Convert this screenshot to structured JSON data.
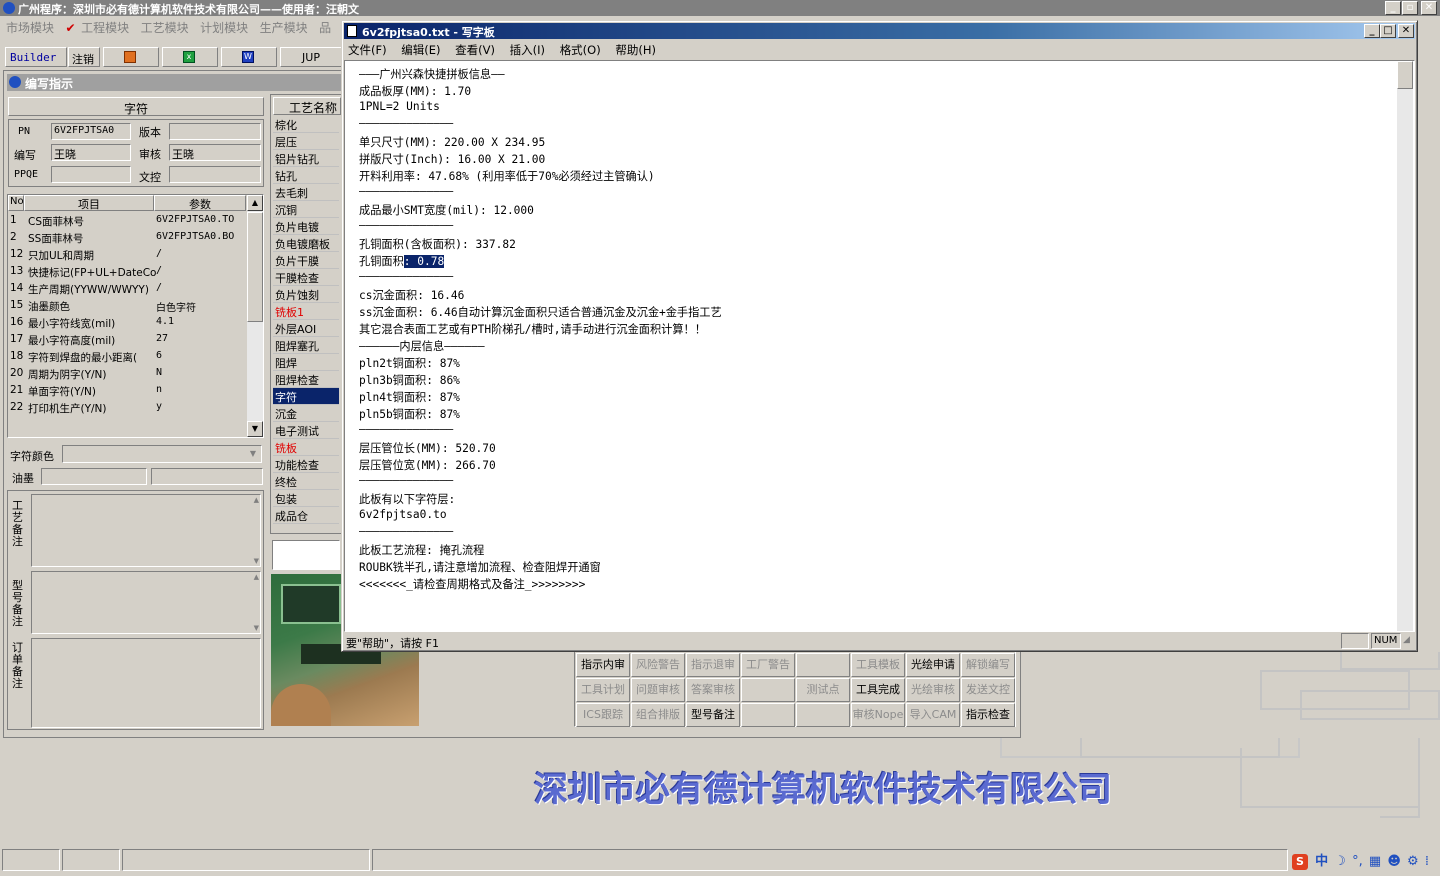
{
  "app": {
    "title": "广州程序：深圳市必有德计算机软件技术有限公司——使用者：汪朝文",
    "menus": [
      "市场模块",
      "工程模块",
      "工艺模块",
      "计划模块",
      "生产模块",
      "品"
    ],
    "toolbar": {
      "builder": "Builder",
      "logout": "注销",
      "jup": "JUP"
    }
  },
  "left_panel": {
    "title": "编写指示",
    "char_header": "字符",
    "pn_label": "PN",
    "pn_value": "6V2FPJTSA0",
    "version_label": "版本",
    "version_value": "",
    "author_label": "编写",
    "author_value": "王晓",
    "review_label": "审核",
    "review_value": "王晓",
    "ppqe_label": "PPQE",
    "ppqe_value": "",
    "doc_label": "文控",
    "doc_value": "",
    "grid_headers": {
      "no": "No",
      "item": "项目",
      "param": "参数"
    },
    "grid_rows": [
      {
        "no": "1",
        "item": "CS面菲林号",
        "value": "6V2FPJTSA0.TO"
      },
      {
        "no": "2",
        "item": "SS面菲林号",
        "value": "6V2FPJTSA0.BO"
      },
      {
        "no": "12",
        "item": "只加UL和周期",
        "value": "/"
      },
      {
        "no": "13",
        "item": "快捷标记(FP+UL+DateCo",
        "value": "/"
      },
      {
        "no": "14",
        "item": "生产周期(YYWW/WWYY)",
        "value": "/"
      },
      {
        "no": "15",
        "item": "油墨颜色",
        "value": "白色字符"
      },
      {
        "no": "16",
        "item": "最小字符线宽(mil)",
        "value": "4.1"
      },
      {
        "no": "17",
        "item": "最小字符高度(mil)",
        "value": "27"
      },
      {
        "no": "18",
        "item": "字符到焊盘的最小距离(",
        "value": "6"
      },
      {
        "no": "20",
        "item": "周期为阴字(Y/N)",
        "value": "N"
      },
      {
        "no": "21",
        "item": "单面字符(Y/N)",
        "value": "n"
      },
      {
        "no": "22",
        "item": "打印机生产(Y/N)",
        "value": "y"
      }
    ],
    "char_color_label": "字符颜色",
    "ink_label": "油墨",
    "process_note_label": "工艺备注",
    "model_note_label": "型号备注",
    "order_note_label": "订单备注"
  },
  "process_list": {
    "header": "工艺名称",
    "items": [
      {
        "label": "棕化",
        "red": false
      },
      {
        "label": "层压",
        "red": false
      },
      {
        "label": "铝片钻孔",
        "red": false
      },
      {
        "label": "钻孔",
        "red": false
      },
      {
        "label": "去毛刺",
        "red": false
      },
      {
        "label": "沉铜",
        "red": false
      },
      {
        "label": "负片电镀",
        "red": false
      },
      {
        "label": "负电镀磨板",
        "red": false
      },
      {
        "label": "负片干膜",
        "red": false
      },
      {
        "label": "干膜检查",
        "red": false
      },
      {
        "label": "负片蚀刻",
        "red": false
      },
      {
        "label": "铣板1",
        "red": true
      },
      {
        "label": "外层AOI",
        "red": false
      },
      {
        "label": "阻焊塞孔",
        "red": false
      },
      {
        "label": "阻焊",
        "red": false
      },
      {
        "label": "阻焊检查",
        "red": false
      },
      {
        "label": "字符",
        "red": false,
        "selected": true
      },
      {
        "label": "沉金",
        "red": false
      },
      {
        "label": "电子测试",
        "red": false
      },
      {
        "label": "铣板",
        "red": true
      },
      {
        "label": "功能检查",
        "red": false
      },
      {
        "label": "终检",
        "red": false
      },
      {
        "label": "包装",
        "red": false
      },
      {
        "label": "成品仓",
        "red": false
      }
    ]
  },
  "bottom_buttons": [
    [
      {
        "label": "指示内审",
        "enabled": true
      },
      {
        "label": "风险警告",
        "enabled": false
      },
      {
        "label": "指示退审",
        "enabled": false
      },
      {
        "label": "工厂警告",
        "enabled": false
      },
      {
        "label": "",
        "enabled": false
      },
      {
        "label": "工具模板",
        "enabled": false
      },
      {
        "label": "光绘申请",
        "enabled": true
      },
      {
        "label": "解锁编写",
        "enabled": false
      }
    ],
    [
      {
        "label": "工具计划",
        "enabled": false
      },
      {
        "label": "问题审核",
        "enabled": false
      },
      {
        "label": "答案审核",
        "enabled": false
      },
      {
        "label": "",
        "enabled": false
      },
      {
        "label": "测试点",
        "enabled": false
      },
      {
        "label": "工具完成",
        "enabled": true
      },
      {
        "label": "光绘审核",
        "enabled": false
      },
      {
        "label": "发送文控",
        "enabled": false
      }
    ],
    [
      {
        "label": "ICS跟踪",
        "enabled": false
      },
      {
        "label": "组合排版",
        "enabled": false
      },
      {
        "label": "型号备注",
        "enabled": true
      },
      {
        "label": "",
        "enabled": false
      },
      {
        "label": "",
        "enabled": false
      },
      {
        "label": "审核Nope",
        "enabled": false
      },
      {
        "label": "导入CAM",
        "enabled": false
      },
      {
        "label": "指示检查",
        "enabled": true
      }
    ]
  ],
  "company_banner": "深圳市必有德计算机软件技术有限公司",
  "wordpad": {
    "title": "6v2fpjtsa0.txt - 写字板",
    "menu": [
      "文件(F)",
      "编辑(E)",
      "查看(V)",
      "插入(I)",
      "格式(O)",
      "帮助(H)"
    ],
    "lines": [
      "———广州兴森快捷拼板信息——",
      "成品板厚(MM): 1.70",
      "1PNL=2 Units",
      "——————————————",
      "单只尺寸(MM): 220.00 X 234.95",
      "拼版尺寸(Inch): 16.00 X 21.00",
      "开料利用率: 47.68% (利用率低于70%必须经过主管确认)",
      "——————————————",
      "成品最小SMT宽度(mil): 12.000",
      "——————————————",
      "孔铜面积(含板面积): 337.82",
      "孔铜面积",
      "——————————————",
      "cs沉金面积: 16.46",
      "ss沉金面积: 6.46自动计算沉金面积只适合普通沉金及沉金+金手指工艺",
      "其它混合表面工艺或有PTH阶梯孔/槽时,请手动进行沉金面积计算！！",
      "——————内层信息——————",
      "pln2t铜面积: 87%",
      "pln3b铜面积: 86%",
      "pln4t铜面积: 87%",
      "pln5b铜面积: 87%",
      "——————————————",
      "层压管位长(MM): 520.70",
      "层压管位宽(MM): 266.70",
      "——————————————",
      "此板有以下字符层:",
      "6v2fpjtsa0.to",
      "——————————————",
      "此板工艺流程: 掩孔流程",
      "ROUBK铣半孔,请注意增加流程、检查阻焊开通窗",
      "<<<<<<<_请检查周期格式及备注_>>>>>>>>"
    ],
    "selected_text": ": 0.78",
    "status_help": "要\"帮助\"，请按 F1",
    "status_num": "NUM"
  }
}
